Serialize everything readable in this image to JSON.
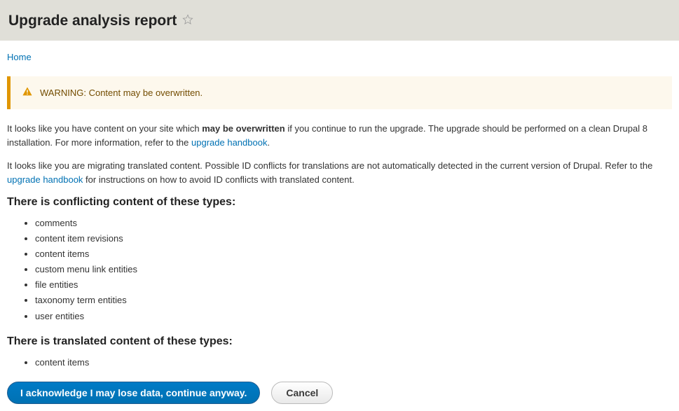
{
  "header": {
    "title": "Upgrade analysis report"
  },
  "breadcrumb": {
    "home": "Home"
  },
  "warning": {
    "text": "WARNING: Content may be overwritten."
  },
  "para1": {
    "pre": "It looks like you have content on your site which ",
    "strong": "may be overwritten",
    "mid": " if you continue to run the upgrade. The upgrade should be performed on a clean Drupal 8 installation. For more information, refer to the ",
    "link": "upgrade handbook",
    "post": "."
  },
  "para2": {
    "pre": "It looks like you are migrating translated content. Possible ID conflicts for translations are not automatically detected in the current version of Drupal. Refer to the ",
    "link": "upgrade handbook",
    "post": " for instructions on how to avoid ID conflicts with translated content."
  },
  "conflicting": {
    "heading": "There is conflicting content of these types:",
    "items": [
      "comments",
      "content item revisions",
      "content items",
      "custom menu link entities",
      "file entities",
      "taxonomy term entities",
      "user entities"
    ]
  },
  "translated": {
    "heading": "There is translated content of these types:",
    "items": [
      "content items"
    ]
  },
  "actions": {
    "acknowledge": "I acknowledge I may lose data, continue anyway.",
    "cancel": "Cancel"
  }
}
